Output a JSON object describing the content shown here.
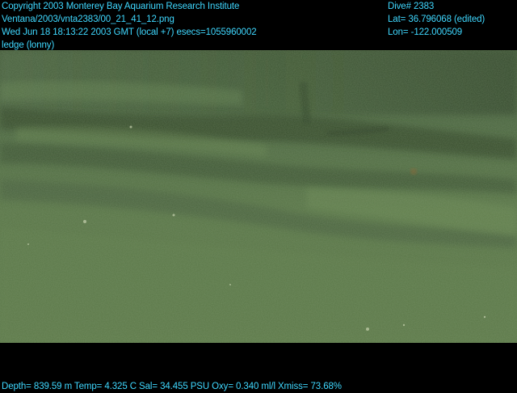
{
  "overlay": {
    "header_left": [
      "Copyright 2003 Monterey Bay Aquarium Research Institute",
      "Ventana/2003/vnta2383/00_21_41_12.png",
      "Wed Jun 18 18:13:22 2003 GMT (local +7)  esecs=1055960002",
      "ledge (lonny)"
    ],
    "header_right": [
      "Dive# 2383",
      "Lat= 36.796068 (edited)",
      "Lon= -122.000509"
    ],
    "footer": "Depth= 839.59 m  Temp= 4.325 C  Sal= 34.455 PSU  Oxy= 0.340 ml/l  Xmiss= 73.68%"
  },
  "colors": {
    "overlay_text": "#3fd8ff",
    "background": "#000000",
    "water_dark": "#3c5131",
    "water_mid": "#506a40",
    "water_light": "#617d4d"
  }
}
